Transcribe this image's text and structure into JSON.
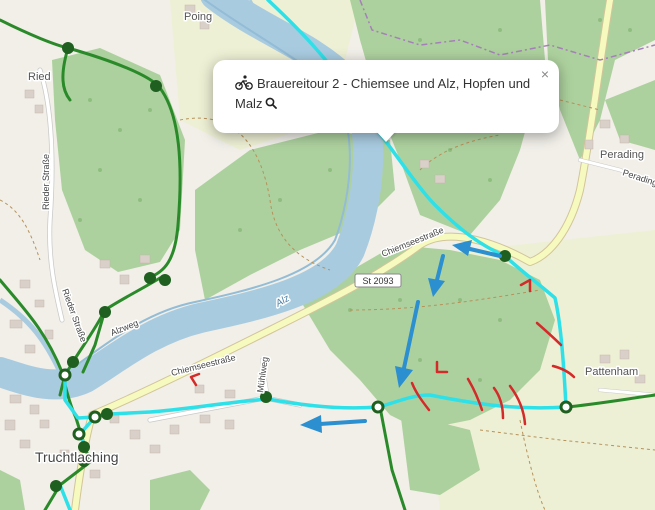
{
  "popup": {
    "title": "Brauereitour 2 - Chiemsee und Alz, Hopfen und Malz",
    "close_symbol": "×",
    "route_icon": "bicycle-icon",
    "action_icon": "magnifier-icon"
  },
  "places": {
    "poing": "Poing",
    "ried": "Ried",
    "perading_1": "Perading",
    "perading_2": "Perading",
    "pattenham": "Pattenham",
    "truchtlaching": "Truchtlaching"
  },
  "roads": {
    "chiemseestrasse_1": "Chiemseestraße",
    "chiemseestrasse_2": "Chiemseestraße",
    "st2093": "St 2093",
    "rieder_strasse_1": "Rieder Straße",
    "rieder_strasse_2": "Rieder Straße",
    "alzweg": "Alzweg",
    "muehlweg": "Mühlweg"
  },
  "water": {
    "alz": "Alz"
  },
  "colors": {
    "route": "#2ee0e8",
    "trail": "#2a8a2a",
    "node": "#1f5f1f",
    "arrow": "#2b8fd0",
    "annotation": "#d42a2a",
    "river": "#a9cbe0",
    "forest": "#add19e",
    "road": "#f7fabf"
  }
}
